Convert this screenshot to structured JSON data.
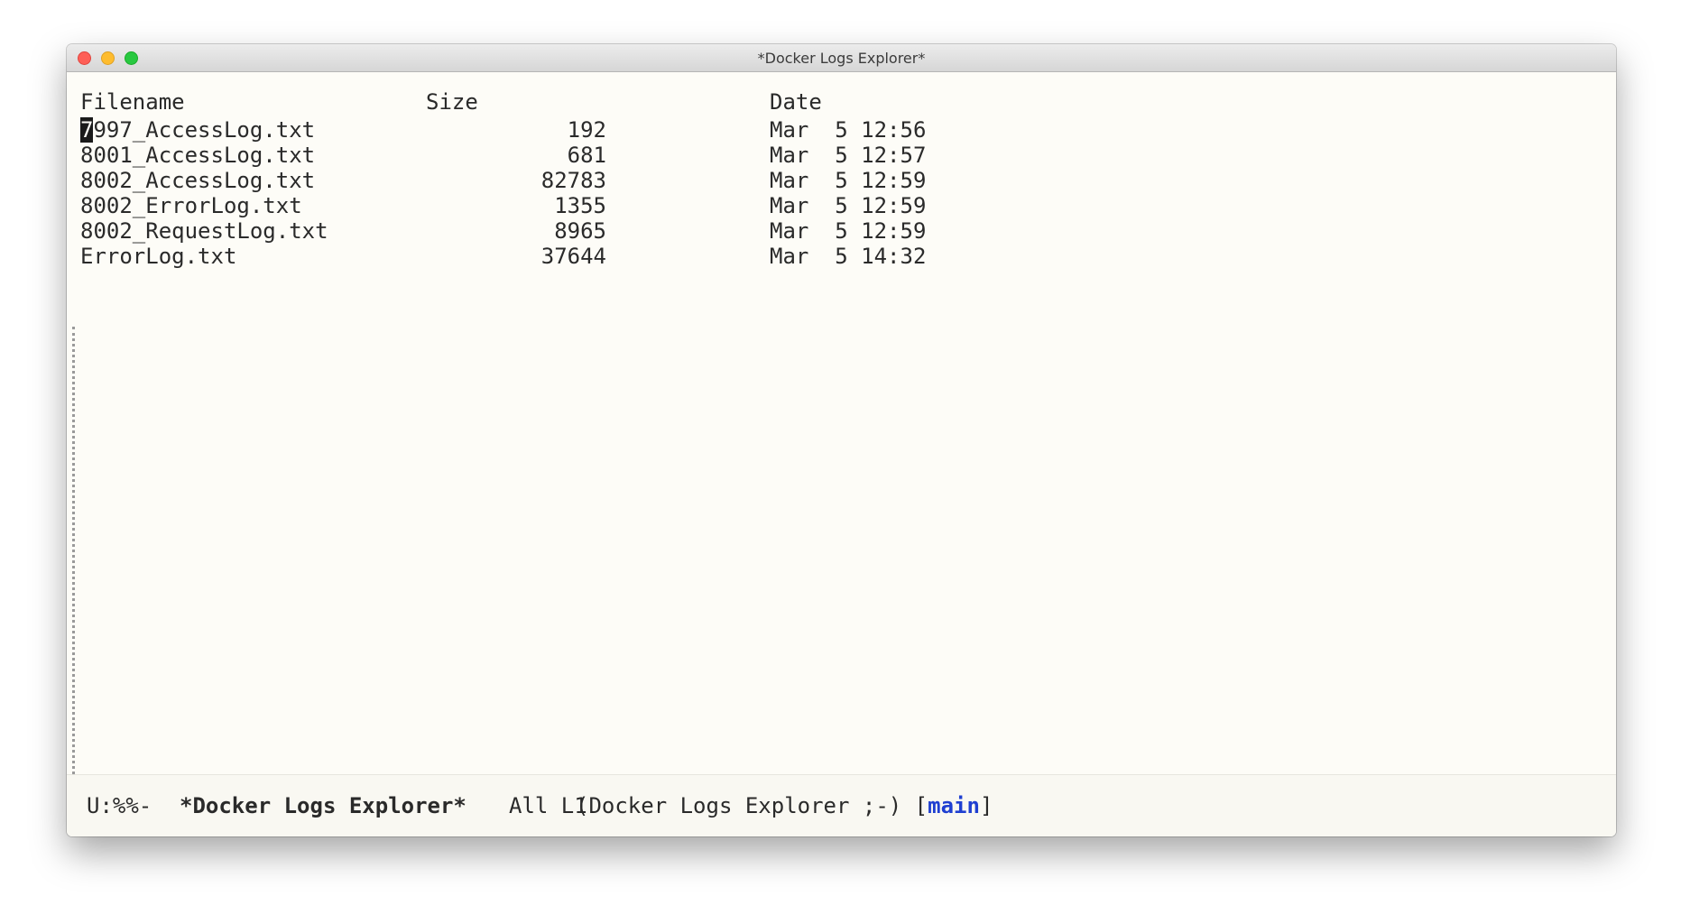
{
  "window": {
    "title": "*Docker Logs Explorer*"
  },
  "table": {
    "headers": {
      "filename": "Filename",
      "size": "Size",
      "date": "Date"
    },
    "rows": [
      {
        "cursor_char": "7",
        "rest": "997_AccessLog.txt",
        "size": "192",
        "date": "Mar  5 12:56"
      },
      {
        "cursor_char": "",
        "rest": "8001_AccessLog.txt",
        "size": "681",
        "date": "Mar  5 12:57"
      },
      {
        "cursor_char": "",
        "rest": "8002_AccessLog.txt",
        "size": "82783",
        "date": "Mar  5 12:59"
      },
      {
        "cursor_char": "",
        "rest": "8002_ErrorLog.txt",
        "size": "1355",
        "date": "Mar  5 12:59"
      },
      {
        "cursor_char": "",
        "rest": "8002_RequestLog.txt",
        "size": "8965",
        "date": "Mar  5 12:59"
      },
      {
        "cursor_char": "",
        "rest": "ErrorLog.txt",
        "size": "37644",
        "date": "Mar  5 14:32"
      }
    ]
  },
  "modeline": {
    "status": "U:%%-",
    "buffer_name": "*Docker Logs Explorer*",
    "position": "All L1",
    "mode_prefix": "(Docker Logs Explorer ;-) [",
    "branch": "main",
    "mode_suffix": "]"
  },
  "colors": {
    "background": "#fdfcf7",
    "branch": "#1f3fd1",
    "close": "#fe5f57",
    "minimize": "#febc2e",
    "maximize": "#28c840"
  }
}
